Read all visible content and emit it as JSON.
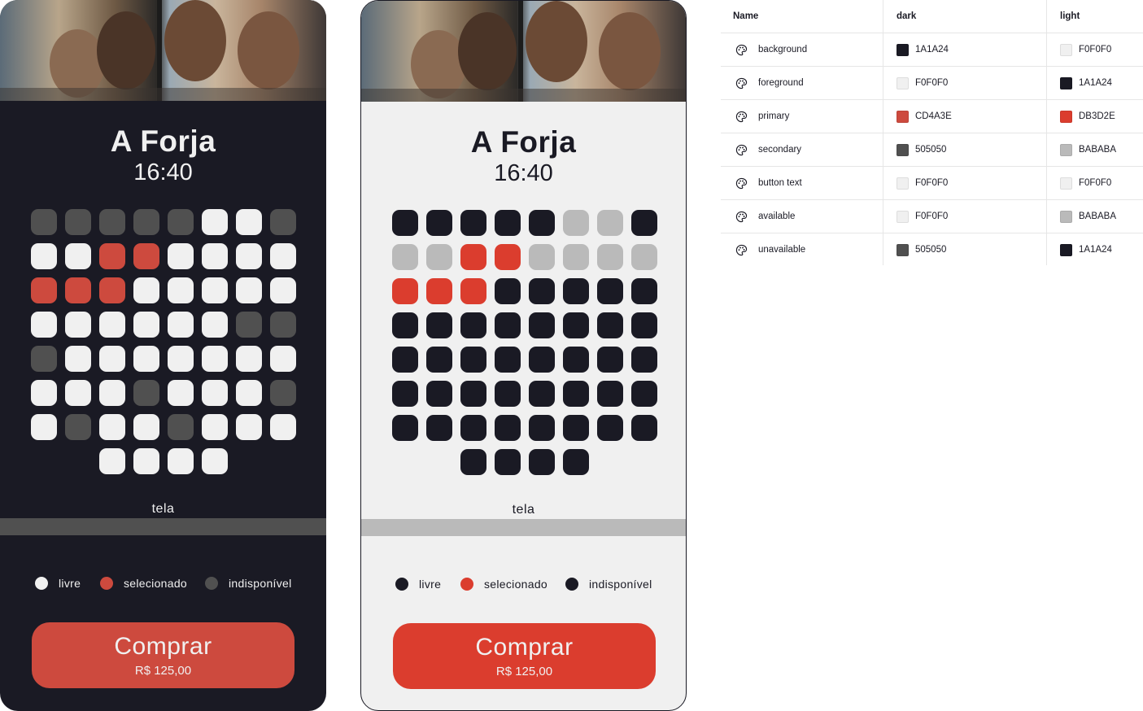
{
  "colors": {
    "dark_background": "#1A1A24",
    "dark_foreground": "#F0F0F0",
    "dark_primary": "#CD4A3E",
    "dark_secondary": "#505050",
    "light_background": "#F0F0F0",
    "light_foreground": "#1A1A24",
    "light_primary": "#DB3D2E",
    "light_secondary": "#BABABA"
  },
  "dark_theme": {
    "poster_icon": "movie-poster-image",
    "title": "A Forja",
    "time": "16:40",
    "seat_rows": [
      [
        "U",
        "U",
        "U",
        "U",
        "U",
        "A",
        "A",
        "U"
      ],
      [
        "A",
        "A",
        "S",
        "S",
        "A",
        "A",
        "A",
        "A"
      ],
      [
        "S",
        "S",
        "S",
        "A",
        "A",
        "A",
        "A",
        "A"
      ],
      [
        "A",
        "A",
        "A",
        "A",
        "A",
        "A",
        "U",
        "U"
      ],
      [
        "U",
        "A",
        "A",
        "A",
        "A",
        "A",
        "A",
        "A"
      ],
      [
        "A",
        "A",
        "A",
        "U",
        "A",
        "A",
        "A",
        "U"
      ],
      [
        "A",
        "U",
        "A",
        "A",
        "U",
        "A",
        "A",
        "A"
      ],
      [
        "A",
        "A",
        "A",
        "A"
      ]
    ],
    "seat_colors": {
      "A": "#F0F0F0",
      "S": "#CD4A3E",
      "U": "#505050"
    },
    "screen_label": "tela",
    "legend": [
      {
        "label": "livre",
        "color": "#F0F0F0"
      },
      {
        "label": "selecionado",
        "color": "#CD4A3E"
      },
      {
        "label": "indisponível",
        "color": "#505050"
      }
    ],
    "buy_label": "Comprar",
    "buy_price": "R$ 125,00",
    "buy_color": "#CD4A3E"
  },
  "light_theme": {
    "poster_icon": "movie-poster-image",
    "title": "A Forja",
    "time": "16:40",
    "seat_rows": [
      [
        "U",
        "U",
        "U",
        "U",
        "U",
        "A",
        "A",
        "U"
      ],
      [
        "A",
        "A",
        "S",
        "S",
        "A",
        "A",
        "A",
        "A"
      ],
      [
        "S",
        "S",
        "S",
        "U",
        "U",
        "U",
        "U",
        "U"
      ],
      [
        "U",
        "U",
        "U",
        "U",
        "U",
        "U",
        "U",
        "U"
      ],
      [
        "U",
        "U",
        "U",
        "U",
        "U",
        "U",
        "U",
        "U"
      ],
      [
        "U",
        "U",
        "U",
        "U",
        "U",
        "U",
        "U",
        "U"
      ],
      [
        "U",
        "U",
        "U",
        "U",
        "U",
        "U",
        "U",
        "U"
      ],
      [
        "U",
        "U",
        "U",
        "U"
      ]
    ],
    "seat_colors": {
      "A": "#BABABA",
      "S": "#DB3D2E",
      "U": "#1A1A24"
    },
    "screen_label": "tela",
    "legend": [
      {
        "label": "livre",
        "color": "#1A1A24"
      },
      {
        "label": "selecionado",
        "color": "#DB3D2E"
      },
      {
        "label": "indisponível",
        "color": "#1A1A24"
      }
    ],
    "buy_label": "Comprar",
    "buy_price": "R$ 125,00",
    "buy_color": "#DB3D2E"
  },
  "token_table": {
    "headers": {
      "name": "Name",
      "dark": "dark",
      "light": "light"
    },
    "icon": "palette-icon",
    "rows": [
      {
        "name": "background",
        "dark": "1A1A24",
        "dark_color": "#1A1A24",
        "light": "F0F0F0",
        "light_color": "#F0F0F0"
      },
      {
        "name": "foreground",
        "dark": "F0F0F0",
        "dark_color": "#F0F0F0",
        "light": "1A1A24",
        "light_color": "#1A1A24"
      },
      {
        "name": "primary",
        "dark": "CD4A3E",
        "dark_color": "#CD4A3E",
        "light": "DB3D2E",
        "light_color": "#DB3D2E"
      },
      {
        "name": "secondary",
        "dark": "505050",
        "dark_color": "#505050",
        "light": "BABABA",
        "light_color": "#BABABA"
      },
      {
        "name": "button text",
        "dark": "F0F0F0",
        "dark_color": "#F0F0F0",
        "light": "F0F0F0",
        "light_color": "#F0F0F0"
      },
      {
        "name": "available",
        "dark": "F0F0F0",
        "dark_color": "#F0F0F0",
        "light": "BABABA",
        "light_color": "#BABABA"
      },
      {
        "name": "unavailable",
        "dark": "505050",
        "dark_color": "#505050",
        "light": "1A1A24",
        "light_color": "#1A1A24"
      }
    ]
  }
}
